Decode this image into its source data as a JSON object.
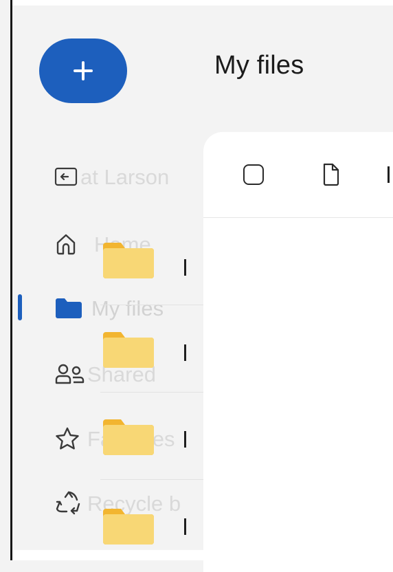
{
  "app": {
    "new_button": {
      "icon": "plus-icon",
      "color": "#1d5fbd"
    },
    "title": "My files"
  },
  "sidebar": {
    "items": [
      {
        "id": "user",
        "label": "Kat Larson",
        "shown_label": "at Larson",
        "icon": "collapse-pane-icon",
        "active": false
      },
      {
        "id": "home",
        "label": "Home",
        "icon": "home-icon",
        "active": false
      },
      {
        "id": "my-files",
        "label": "My files",
        "icon": "folder-icon",
        "active": true
      },
      {
        "id": "shared",
        "label": "Shared",
        "icon": "people-icon",
        "active": false
      },
      {
        "id": "favorites",
        "label": "Favorites",
        "icon": "star-icon",
        "active": false
      },
      {
        "id": "recycle-bin",
        "label": "Recycle b",
        "icon": "recycle-icon",
        "active": false
      }
    ],
    "accent_color": "#1d5fbd"
  },
  "file_list": {
    "header": {
      "select_all_icon": "checkbox-icon",
      "type_icon": "file-icon"
    },
    "rows": [
      {
        "icon": "folder-icon"
      },
      {
        "icon": "folder-icon"
      },
      {
        "icon": "folder-icon"
      },
      {
        "icon": "folder-icon"
      }
    ],
    "folder_color": "#f8d775"
  }
}
